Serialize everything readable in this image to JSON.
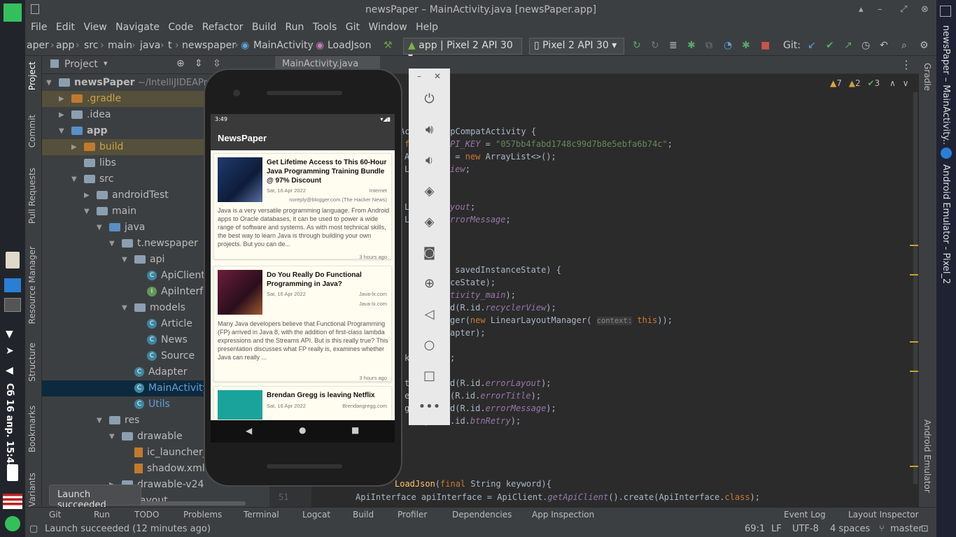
{
  "window": {
    "title": "newsPaper – MainActivity.java [newsPaper.app]"
  },
  "menu": [
    "File",
    "Edit",
    "View",
    "Navigate",
    "Code",
    "Refactor",
    "Build",
    "Run",
    "Tools",
    "Git",
    "Window",
    "Help"
  ],
  "breadcrumb": [
    "aper",
    "app",
    "src",
    "main",
    "java",
    "t",
    "newspaper",
    "MainActivity",
    "LoadJson"
  ],
  "toolbar": {
    "run_config": "app | Pixel 2 API 30",
    "device": "Pixel 2 API 30",
    "git_label": "Git:"
  },
  "project": {
    "header": "Project",
    "root": "newsPaper",
    "root_path": "~/IntelliJIDEAProje",
    "items": [
      ".gradle",
      ".idea",
      "app",
      "build",
      "libs",
      "src",
      "androidTest",
      "main",
      "java",
      "t.newspaper",
      "api",
      "ApiClient",
      "ApiInterfa",
      "models",
      "Article",
      "News",
      "Source",
      "Adapter",
      "MainActivity",
      "Utils",
      "res",
      "drawable",
      "ic_launcher_b",
      "shadow.xml",
      "drawable-v24",
      "layout"
    ]
  },
  "left_tabs": [
    "Project",
    "Commit",
    "Pull Requests",
    "Resource Manager",
    "Structure",
    "Bookmarks",
    "Variants"
  ],
  "right_tabs": [
    "Gradle",
    "Android Emulator"
  ],
  "editor": {
    "tab": "MainActivity.java",
    "inspections": {
      "warnings": "7",
      "weak": "2",
      "typos": "3"
    },
    "api_key": "\"057bb4fabd1748c99d7b8e5ebfa6b74c\"",
    "line_no": "51",
    "hint": "context:"
  },
  "phone": {
    "time": "3:49",
    "app_title": "NewsPaper",
    "articles": [
      {
        "title": "Get Lifetime Access to This 60-Hour Java Programming Training Bundle @ 97% Discount",
        "date": "Sat, 16 Apr 2022",
        "source": "Internet",
        "author": "noreply@blogger.com (The Hacker News)",
        "desc": "Java is a very versatile programming language. From Android apps to Oracle databases, it can be used to power a wide range of software and systems. As with most technical skills, the best way to learn Java is through building your own projects. But you can de...",
        "ago": "3 hours ago",
        "color": "#1f3a6b"
      },
      {
        "title": "Do You Really Do Functional Programming in Java?",
        "date": "Sat, 16 Apr 2022",
        "source": "Java-lx.com",
        "author": "Java-lx.com",
        "desc": "Many Java developers believe that Functional Programming (FP) arrived in Java 8, with the addition of first-class lambda expressions and the Streams API. But is this really true? This presentation discusses what FP really is, examines whether Java can really ...",
        "ago": "3 hours ago",
        "color": "#4a1e3a"
      },
      {
        "title": "Brendan Gregg is leaving Netflix",
        "date": "Sat, 16 Apr 2022",
        "source": "Brendangregg.com",
        "color": "#1aa39a"
      }
    ]
  },
  "tool_windows": [
    "Git",
    "Run",
    "TODO",
    "Problems",
    "Terminal",
    "Logcat",
    "Build",
    "Profiler",
    "Dependencies",
    "App Inspection",
    "Event Log",
    "Layout Inspector"
  ],
  "status": {
    "message": "Launch succeeded (12 minutes ago)",
    "position": "69:1",
    "line_sep": "LF",
    "encoding": "UTF-8",
    "indent": "4 spaces",
    "branch": "master"
  },
  "toast": "Launch succeeded",
  "taskbar_right": {
    "title": "newsPaper – MainActivity...",
    "title2": "Android Emulator - Pixel_2..."
  },
  "taskbar_left": {
    "clock": "Сб 16 апр. 15:48"
  }
}
